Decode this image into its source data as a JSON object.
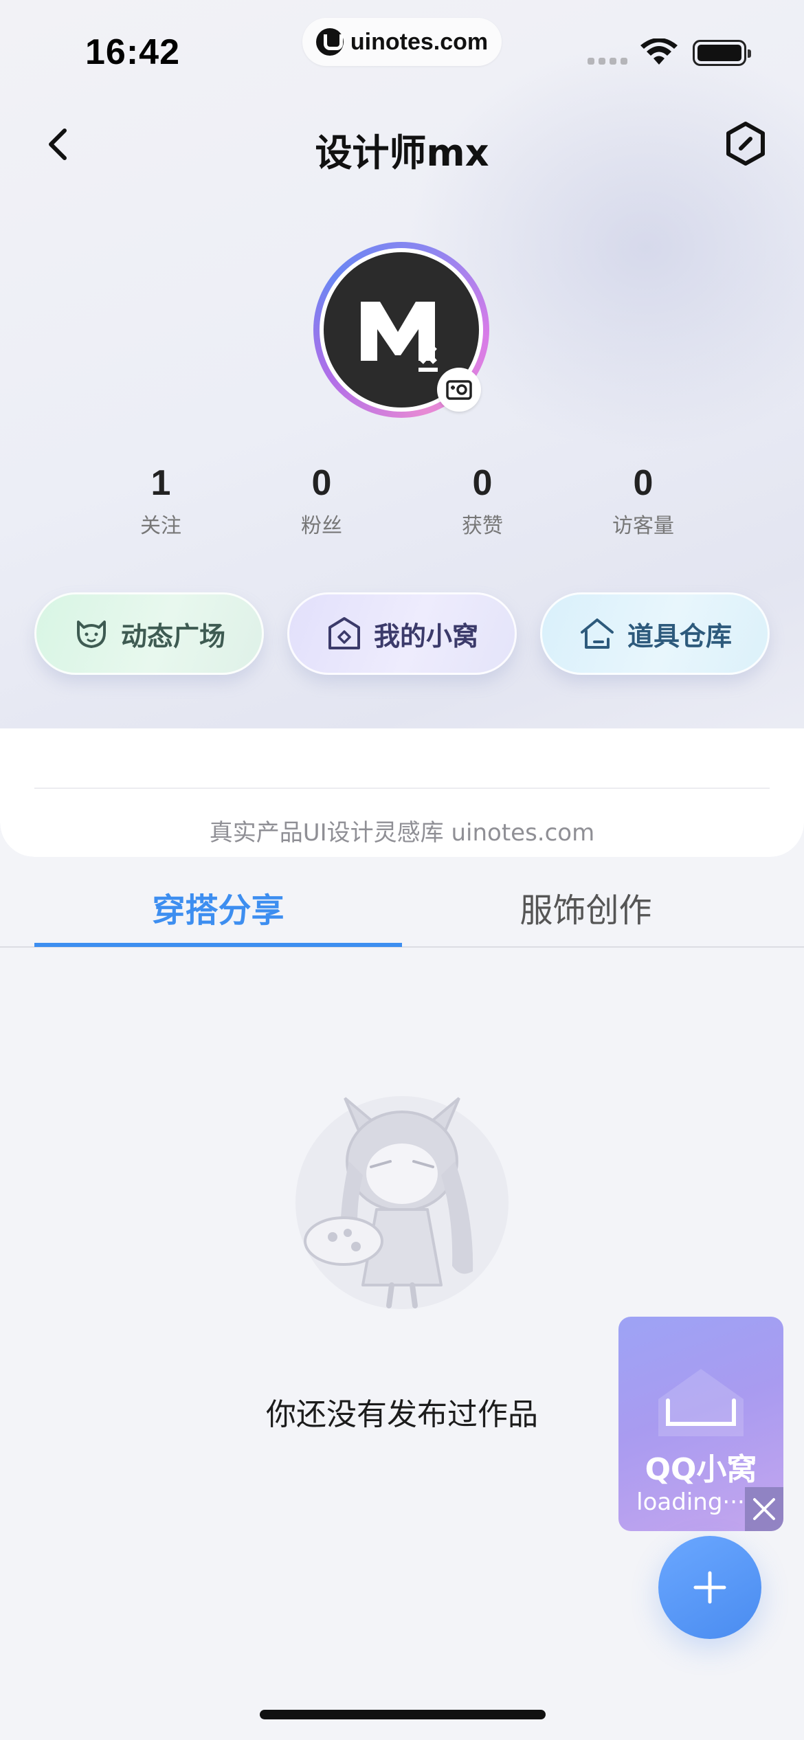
{
  "status_bar": {
    "time": "16:42",
    "url": "uinotes.com",
    "icons": [
      "signal-icon",
      "wifi-icon",
      "battery-icon"
    ]
  },
  "nav": {
    "title": "设计师mx",
    "back_icon": "chevron-left-icon",
    "settings_icon": "hexagon-settings-icon"
  },
  "profile": {
    "avatar_icon": "mx-logo-avatar",
    "camera_icon": "camera-icon"
  },
  "stats": [
    {
      "value": "1",
      "label": "关注"
    },
    {
      "value": "0",
      "label": "粉丝"
    },
    {
      "value": "0",
      "label": "获赞"
    },
    {
      "value": "0",
      "label": "访客量"
    }
  ],
  "quick_actions": [
    {
      "label": "动态广场",
      "icon": "cat-face-icon",
      "color": "#3e5b52"
    },
    {
      "label": "我的小窝",
      "icon": "house-diamond-icon",
      "color": "#3b3a6a"
    },
    {
      "label": "道具仓库",
      "icon": "house-outline-icon",
      "color": "#2d5a7c"
    }
  ],
  "watermark": "真实产品UI设计灵感库 uinotes.com",
  "tabs": [
    {
      "label": "穿搭分享",
      "active": true
    },
    {
      "label": "服饰创作",
      "active": false
    }
  ],
  "empty_state": {
    "text": "你还没有发布过作品",
    "illustration": "character-girl-illustration"
  },
  "floating": {
    "qq_title": "QQ小窝",
    "qq_loading": "loading···",
    "close_icon": "close-icon",
    "fab_icon": "plus-icon"
  },
  "colors": {
    "accent": "#3d8ef0",
    "fab": "#4a8cf0"
  }
}
